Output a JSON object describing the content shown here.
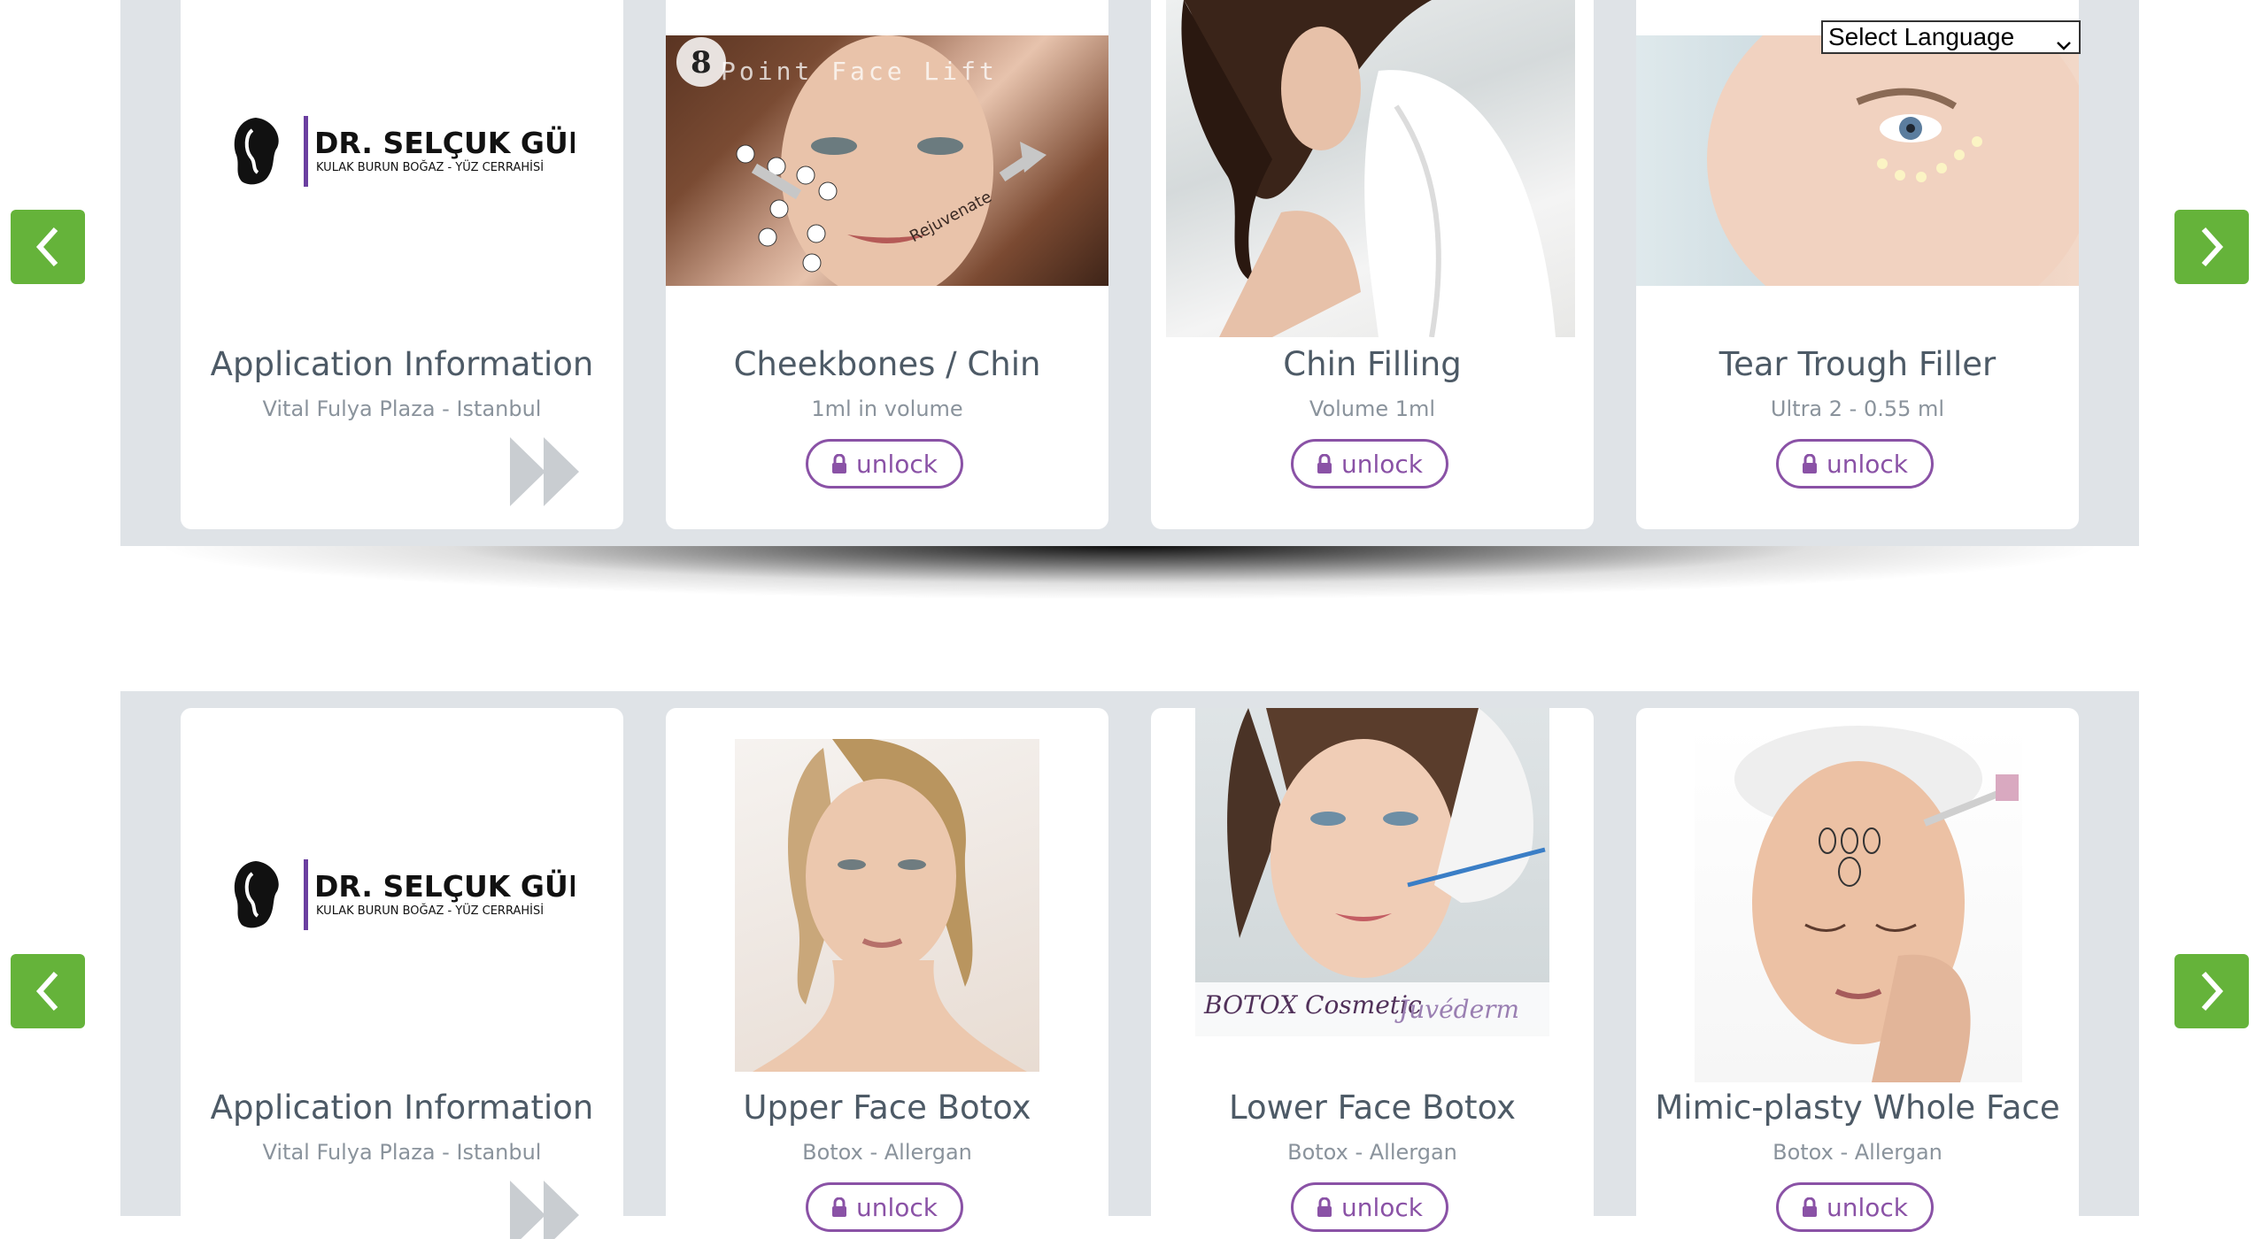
{
  "language_select": {
    "label": "Select Language"
  },
  "brand": {
    "name": "DR. SELÇUK GÜNEY",
    "tagline": "KULAK BURUN BOĞAZ - YÜZ CERRAHİSİ"
  },
  "row1": {
    "cards": [
      {
        "title": "Application Information",
        "subtitle": "Vital Fulya Plaza - Istanbul"
      },
      {
        "title": "Cheekbones / Chin",
        "subtitle": "1ml in volume",
        "button": "unlock",
        "image_text": "8 Point Face Lift",
        "image_tags": [
          "Lift",
          "Rejuvenate"
        ]
      },
      {
        "title": "Chin Filling",
        "subtitle": "Volume 1ml",
        "button": "unlock"
      },
      {
        "title": "Tear Trough Filler",
        "subtitle": "Ultra 2 - 0.55 ml",
        "button": "unlock"
      }
    ]
  },
  "row2": {
    "cards": [
      {
        "title": "Application Information",
        "subtitle": "Vital Fulya Plaza - Istanbul"
      },
      {
        "title": "Upper Face Botox",
        "subtitle": "Botox - Allergan",
        "button": "unlock"
      },
      {
        "title": "Lower Face Botox",
        "subtitle": "Botox - Allergan",
        "button": "unlock",
        "image_brands": [
          "BOTOX Cosmetic",
          "Juvéderm"
        ]
      },
      {
        "title": "Mimic-plasty Whole Face",
        "subtitle": "Botox - Allergan",
        "button": "unlock"
      }
    ]
  },
  "colors": {
    "accent": "#8a52a6",
    "nav": "#65b33a",
    "band": "#dfe3e7"
  },
  "icons": [
    "chevron-left-icon",
    "chevron-right-icon",
    "lock-icon",
    "fast-forward-icon",
    "dropdown-chevron-icon"
  ]
}
